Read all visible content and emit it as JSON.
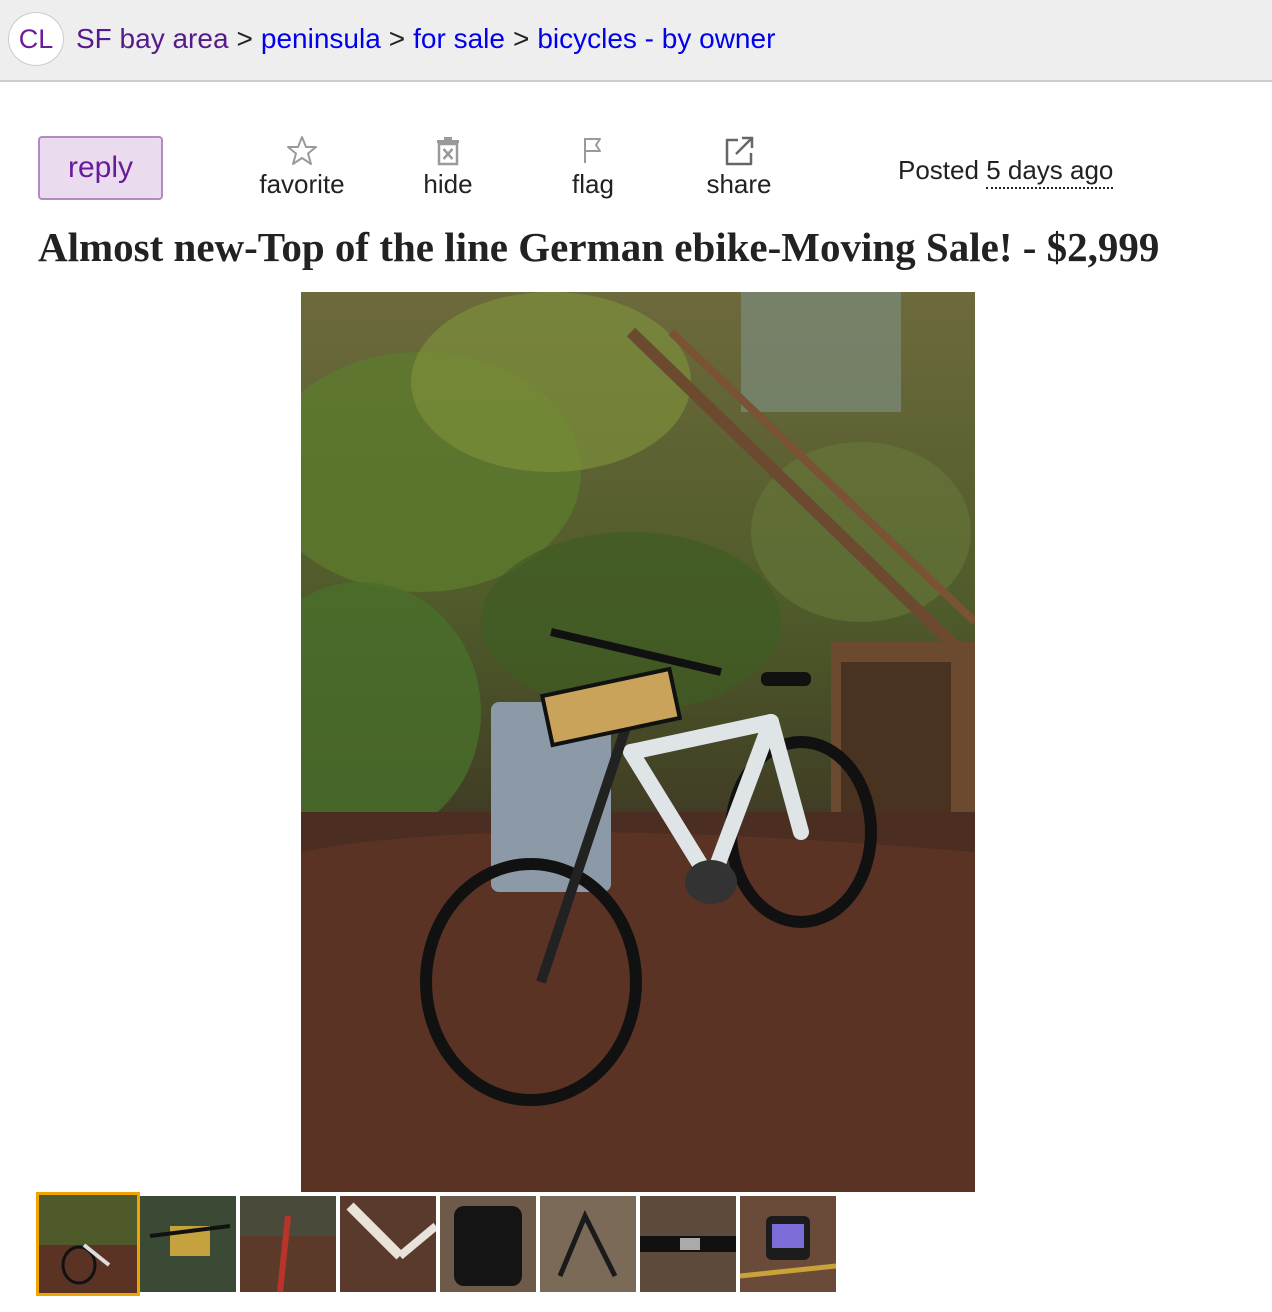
{
  "logo": {
    "text": "CL"
  },
  "breadcrumb": {
    "area": "SF bay area",
    "separator": ">",
    "items": [
      "peninsula",
      "for sale",
      "bicycles - by owner"
    ]
  },
  "actions": {
    "reply": "reply",
    "favorite": "favorite",
    "hide": "hide",
    "flag": "flag",
    "share": "share"
  },
  "posted": {
    "label": "Posted",
    "relative": "5 days ago"
  },
  "listing": {
    "title": "Almost new-Top of the line German ebike-Moving Sale! - $2,999"
  },
  "gallery": {
    "main_image": "ebike-photo",
    "thumbnails": [
      {
        "name": "ebike-in-yard",
        "selected": true
      },
      {
        "name": "bike-basket-top-view",
        "selected": false
      },
      {
        "name": "bike-on-path",
        "selected": false
      },
      {
        "name": "bike-frame-detail",
        "selected": false
      },
      {
        "name": "black-bag",
        "selected": false
      },
      {
        "name": "bike-stand-part",
        "selected": false
      },
      {
        "name": "strap-accessory",
        "selected": false
      },
      {
        "name": "bike-display",
        "selected": false
      }
    ]
  },
  "colors": {
    "link": "#0000ee",
    "visited": "#551a8b",
    "reply_bg": "#eadcee",
    "reply_text": "#6a1b9a",
    "thumb_selected": "#f0a400"
  }
}
